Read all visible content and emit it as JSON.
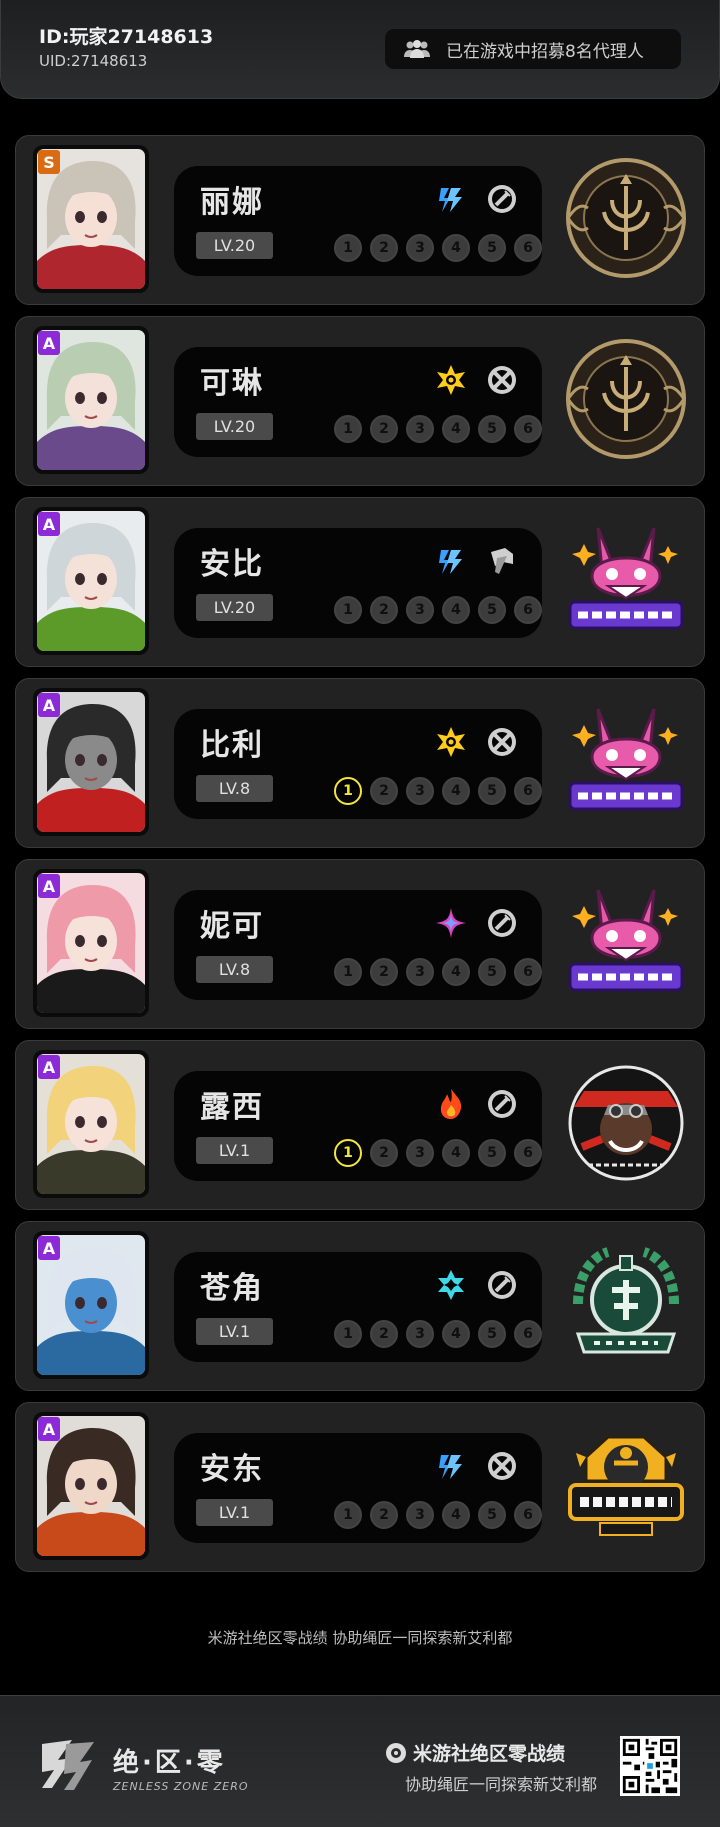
{
  "header": {
    "player_id": "ID:玩家27148613",
    "uid": "UID:27148613",
    "recruit_text": "已在游戏中招募8名代理人",
    "recruit_icon": "group-icon"
  },
  "agents": [
    {
      "name": "丽娜",
      "level": "LV.20",
      "rank": "S",
      "element": "electric",
      "role": "support",
      "faction": "victoria-housekeeping",
      "mindscape_unlocked": 0
    },
    {
      "name": "可琳",
      "level": "LV.20",
      "rank": "A",
      "element": "physical",
      "role": "attack",
      "faction": "victoria-housekeeping",
      "mindscape_unlocked": 0
    },
    {
      "name": "安比",
      "level": "LV.20",
      "rank": "A",
      "element": "electric",
      "role": "stun",
      "faction": "cunning-hares",
      "mindscape_unlocked": 0
    },
    {
      "name": "比利",
      "level": "LV.8",
      "rank": "A",
      "element": "physical",
      "role": "attack",
      "faction": "cunning-hares",
      "mindscape_unlocked": 1
    },
    {
      "name": "妮可",
      "level": "LV.8",
      "rank": "A",
      "element": "ether",
      "role": "support",
      "faction": "cunning-hares",
      "mindscape_unlocked": 0
    },
    {
      "name": "露西",
      "level": "LV.1",
      "rank": "A",
      "element": "fire",
      "role": "support",
      "faction": "sons-of-calydon",
      "mindscape_unlocked": 1
    },
    {
      "name": "苍角",
      "level": "LV.1",
      "rank": "A",
      "element": "ice",
      "role": "support",
      "faction": "hsos6",
      "mindscape_unlocked": 0
    },
    {
      "name": "安东",
      "level": "LV.1",
      "rank": "A",
      "element": "electric",
      "role": "attack",
      "faction": "belobog",
      "mindscape_unlocked": 0
    }
  ],
  "mindscape_labels": [
    "1",
    "2",
    "3",
    "4",
    "5",
    "6"
  ],
  "promo": "米游社绝区零战绩 协助绳匠一同探索新艾利都",
  "footer": {
    "game_logo_text": "绝·区·零",
    "game_logo_sub": "ZENLESS ZONE ZERO",
    "brand_title": "米游社绝区零战绩",
    "brand_subtitle": "协助绳匠一同探索新艾利都"
  },
  "colors": {
    "background": "#000000",
    "card": "#222222",
    "mindscape_on": "#f4e53a",
    "rank_s": "#d96c13",
    "rank_a": "#8b2ad6"
  }
}
